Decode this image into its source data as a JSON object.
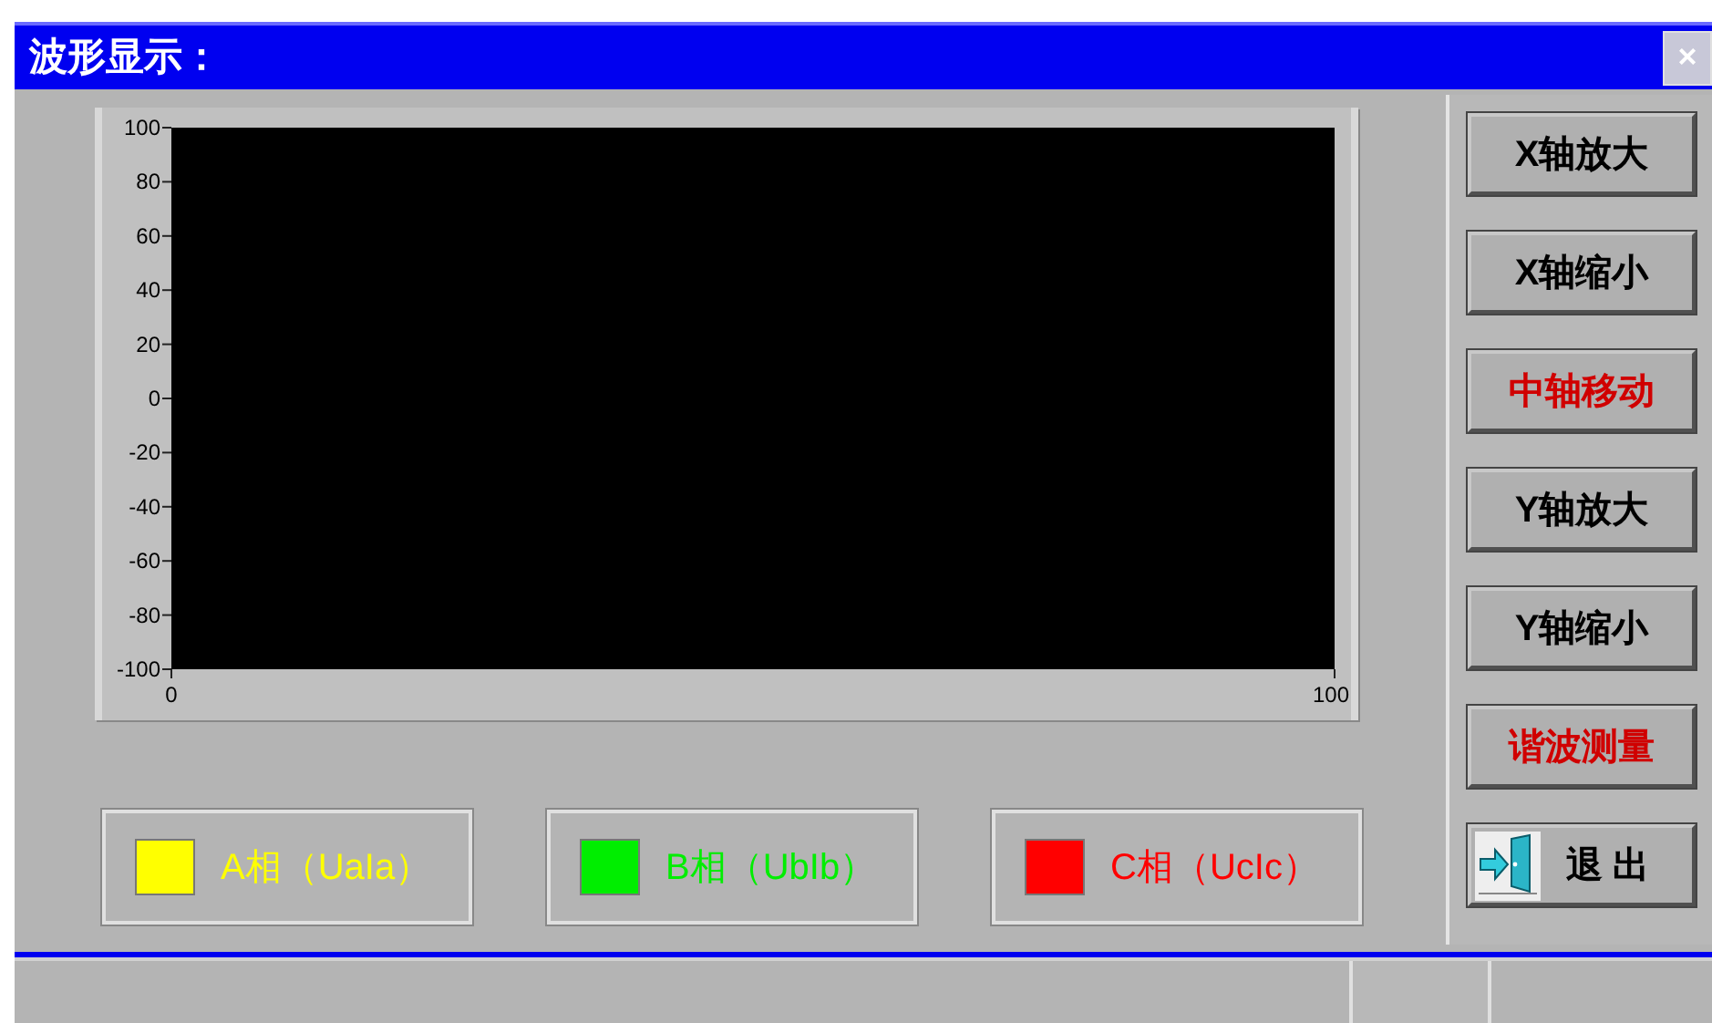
{
  "window": {
    "title": "波形显示：",
    "close": "×"
  },
  "chart": {
    "chart_data": {
      "type": "line",
      "xlim": [
        0,
        100
      ],
      "ylim": [
        -100,
        100
      ],
      "xticks": [
        0,
        100
      ],
      "yticks": [
        100,
        80,
        60,
        40,
        20,
        0,
        -20,
        -40,
        -60,
        -80,
        -100
      ]
    }
  },
  "legend": [
    {
      "label": "A相（UaIa）",
      "color": "#ffff00"
    },
    {
      "label": "B相（UbIb）",
      "color": "#00ee00"
    },
    {
      "label": "C相（UcIc）",
      "color": "#ff0000"
    }
  ],
  "buttons": [
    {
      "label": "X轴放大",
      "color": "#000000",
      "kind": "text"
    },
    {
      "label": "X轴缩小",
      "color": "#000000",
      "kind": "text"
    },
    {
      "label": "中轴移动",
      "color": "#d00000",
      "kind": "text"
    },
    {
      "label": "Y轴放大",
      "color": "#000000",
      "kind": "text"
    },
    {
      "label": "Y轴缩小",
      "color": "#000000",
      "kind": "text"
    },
    {
      "label": "谐波测量",
      "color": "#d00000",
      "kind": "text"
    },
    {
      "label": "退 出",
      "color": "#000000",
      "kind": "exit"
    }
  ]
}
